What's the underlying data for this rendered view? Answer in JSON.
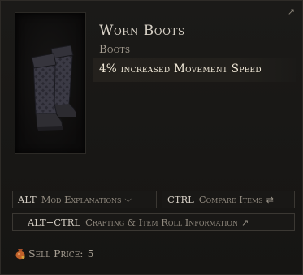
{
  "item": {
    "name": "Worn Boots",
    "type": "Boots",
    "modifier": "4% increased Movement Speed",
    "icon": "worn-boots"
  },
  "actions": {
    "mod_explanations": {
      "key": "ALT",
      "label": "Mod Explanations",
      "icon": "chevron-down"
    },
    "compare_items": {
      "key": "CTRL",
      "label": "Compare Items",
      "icon": "swap"
    },
    "crafting_info": {
      "key": "ALT+CTRL",
      "label": "Crafting & Item Roll Information",
      "icon": "arrow-up-right"
    }
  },
  "sell": {
    "label": "Sell Price:",
    "value": "5",
    "icon": "coin-bag"
  },
  "colors": {
    "background": "#181715",
    "name": "#d7d1c6",
    "modifier": "#efe7d6",
    "muted": "#a79f93",
    "coin": "#c0612a"
  }
}
